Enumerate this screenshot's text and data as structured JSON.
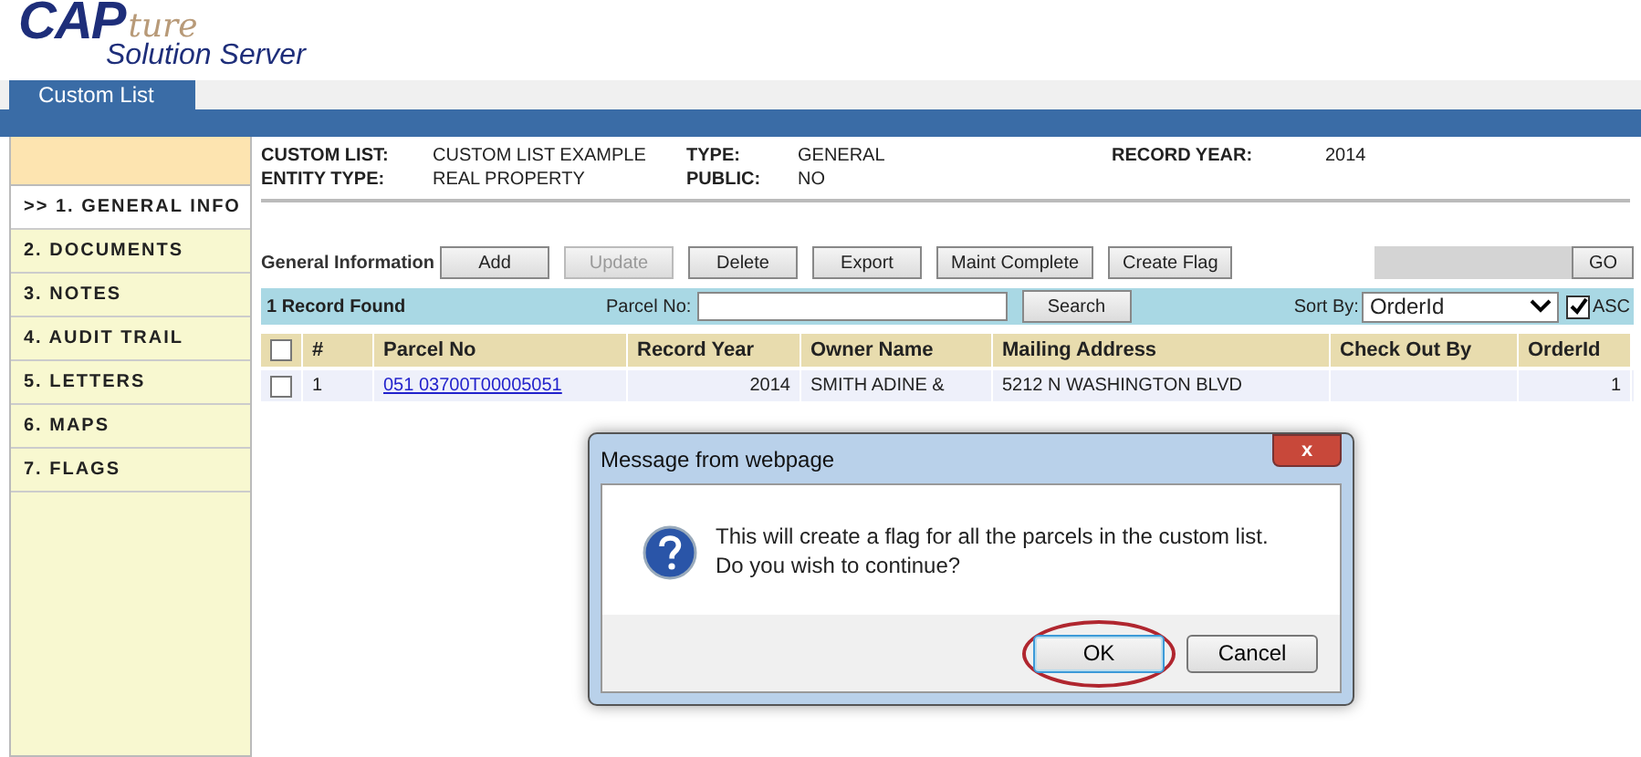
{
  "logo": {
    "primary": "CAP",
    "script": "ture",
    "subtitle": "Solution Server"
  },
  "tabs": [
    {
      "label": "Custom List",
      "selected": true
    }
  ],
  "nav": [
    {
      "label": ">> 1. GENERAL INFO",
      "selected": true
    },
    {
      "label": "2. DOCUMENTS",
      "selected": false
    },
    {
      "label": "3. NOTES",
      "selected": false
    },
    {
      "label": "4. AUDIT TRAIL",
      "selected": false
    },
    {
      "label": "5. LETTERS",
      "selected": false
    },
    {
      "label": "6. MAPS",
      "selected": false
    },
    {
      "label": "7. FLAGS",
      "selected": false
    }
  ],
  "info": [
    {
      "label": "CUSTOM LIST:",
      "value": "CUSTOM LIST EXAMPLE"
    },
    {
      "label": "TYPE:",
      "value": "GENERAL"
    },
    {
      "label": "RECORD YEAR:",
      "value": "2014"
    },
    {
      "label": "ENTITY TYPE:",
      "value": "REAL PROPERTY"
    },
    {
      "label": "PUBLIC:",
      "value": "NO"
    }
  ],
  "toolbar": {
    "label": "General Information",
    "buttons": [
      {
        "label": "Add",
        "disabled": false
      },
      {
        "label": "Update",
        "disabled": true
      },
      {
        "label": "Delete",
        "disabled": false
      },
      {
        "label": "Export",
        "disabled": false
      },
      {
        "label": "Maint Complete",
        "disabled": false
      },
      {
        "label": "Create Flag",
        "disabled": false
      }
    ],
    "go": "GO"
  },
  "search": {
    "count": "1 Record Found",
    "parcel_label": "Parcel No:",
    "button": "Search",
    "sort_label": "Sort By:",
    "sort_value": "OrderId",
    "asc_label": "ASC",
    "asc_checked": true
  },
  "table": {
    "select_all_checked": false,
    "columns": [
      "#",
      "Parcel No",
      "Record Year",
      "Owner Name",
      "Mailing Address",
      "Check Out By",
      "OrderId"
    ],
    "rows": [
      {
        "checked": false,
        "cells": [
          "1",
          "051 03700T00005051",
          "2014",
          "SMITH ADINE &",
          "5212 N WASHINGTON BLVD",
          "",
          "1"
        ]
      }
    ]
  },
  "dialog": {
    "title": "Message from webpage",
    "close": "x",
    "message": "This will create a flag for all the parcels in the custom list. Do you wish to continue?",
    "buttons": [
      {
        "label": "OK",
        "selected": true
      },
      {
        "label": "Cancel",
        "selected": false
      }
    ]
  }
}
